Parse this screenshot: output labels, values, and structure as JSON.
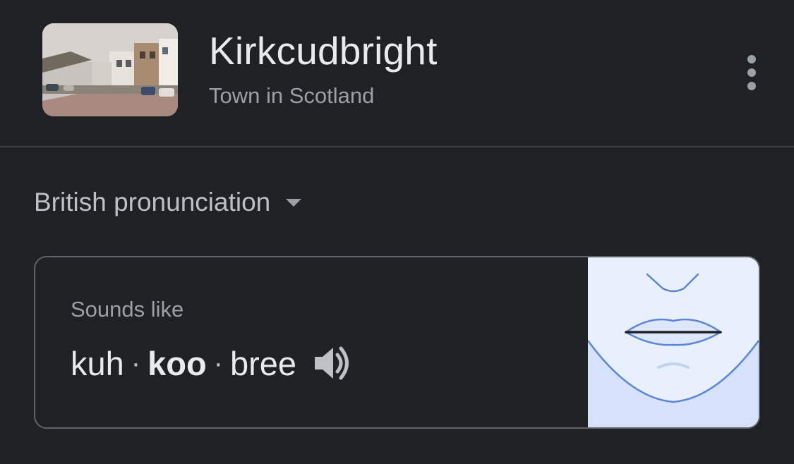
{
  "entity": {
    "title": "Kirkcudbright",
    "subtitle": "Town in Scotland"
  },
  "pronunciation": {
    "language_label": "British pronunciation",
    "sounds_like_label": "Sounds like",
    "syllables": [
      "kuh",
      "koo",
      "bree"
    ],
    "stressed_index": 1,
    "separator": "·"
  },
  "icons": {
    "more": "more-vert-icon",
    "dropdown": "arrow-drop-down-icon",
    "audio": "volume-up-icon",
    "mouth": "mouth-diagram-icon"
  },
  "colors": {
    "background": "#202124",
    "text_primary": "#e8eaed",
    "text_secondary": "#9aa0a6",
    "border": "#5f6368",
    "mouth_bg": "#e8f0fe",
    "mouth_line": "#4f7fd6"
  }
}
